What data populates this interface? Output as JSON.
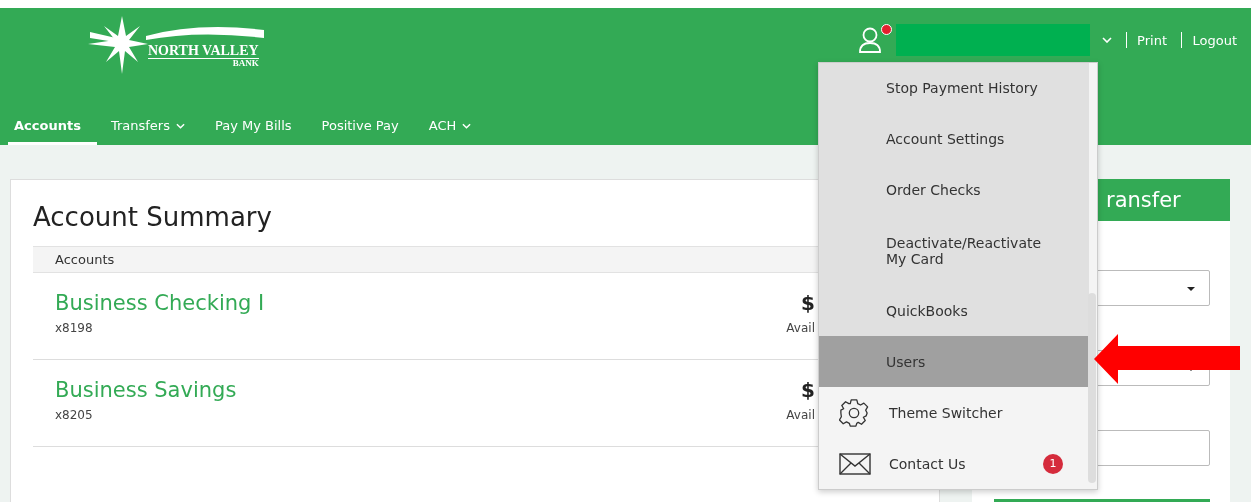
{
  "header": {
    "logo": {
      "name": "NORTH VALLEY",
      "sub": "BANK"
    },
    "user_notification": true,
    "links": [
      "Print",
      "Logout"
    ]
  },
  "nav": [
    {
      "label": "Accounts",
      "selected": true,
      "dropdown": false
    },
    {
      "label": "Transfers",
      "selected": false,
      "dropdown": true
    },
    {
      "label": "Pay My Bills",
      "selected": false,
      "dropdown": false
    },
    {
      "label": "Positive Pay",
      "selected": false,
      "dropdown": false
    },
    {
      "label": "ACH",
      "selected": false,
      "dropdown": true
    }
  ],
  "summary": {
    "title": "Account Summary",
    "column": "Accounts",
    "accounts": [
      {
        "name": "Business Checking I",
        "number": "x8198",
        "amount": "$",
        "note": "Avail"
      },
      {
        "name": "Business Savings",
        "number": "x8205",
        "amount": "$",
        "note": "Avail"
      }
    ]
  },
  "transfer_panel": {
    "title": "ransfer"
  },
  "menu": [
    {
      "kind": "link",
      "label": "Stop Payment History",
      "selected": false
    },
    {
      "kind": "link",
      "label": "Account Settings",
      "selected": false
    },
    {
      "kind": "link",
      "label": "Order Checks",
      "selected": false
    },
    {
      "kind": "link",
      "label": "Deactivate/Reactivate My Card",
      "selected": false
    },
    {
      "kind": "link",
      "label": "QuickBooks",
      "selected": false
    },
    {
      "kind": "link",
      "label": "Users",
      "selected": true
    },
    {
      "kind": "gear",
      "label": "Theme Switcher",
      "selected": false
    },
    {
      "kind": "mail",
      "label": "Contact Us",
      "selected": false,
      "badge": "1"
    }
  ]
}
